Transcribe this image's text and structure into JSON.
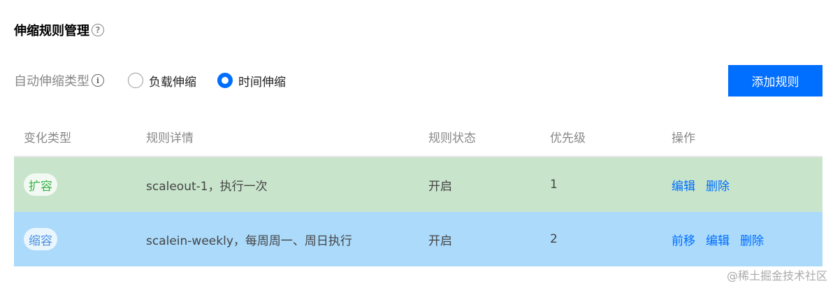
{
  "page": {
    "title": "伸缩规则管理",
    "help_glyph": "?"
  },
  "scaling_type": {
    "label": "自动伸缩类型",
    "info_glyph": "i",
    "options": [
      {
        "label": "负载伸缩",
        "checked": false
      },
      {
        "label": "时间伸缩",
        "checked": true
      }
    ]
  },
  "toolbar": {
    "add_rule_label": "添加规则"
  },
  "table": {
    "headers": [
      "变化类型",
      "规则详情",
      "规则状态",
      "优先级",
      "操作"
    ],
    "rows": [
      {
        "type": "扩容",
        "type_color": "#3bb346",
        "detail": "scaleout-1，执行一次",
        "status": "开启",
        "priority": "1",
        "bg": "#c8e5cc",
        "actions": [
          "编辑",
          "删除"
        ]
      },
      {
        "type": "缩容",
        "type_color": "#4a90e2",
        "detail": "scalein-weekly，每周周一、周日执行",
        "status": "开启",
        "priority": "2",
        "bg": "#abdafb",
        "actions": [
          "前移",
          "编辑",
          "删除"
        ]
      }
    ]
  },
  "watermark": "@稀土掘金技术社区",
  "colors": {
    "accent": "#006eff"
  }
}
